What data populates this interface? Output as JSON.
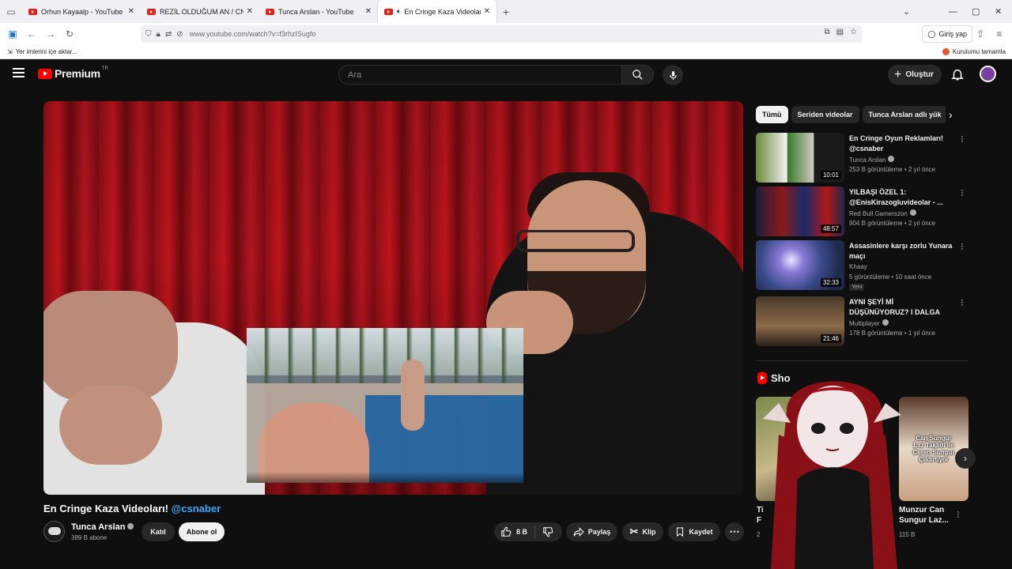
{
  "browser": {
    "tabs": [
      {
        "label": "Orhun Kayaalp - YouTube",
        "active": false
      },
      {
        "label": "REZİL OLDUĞUM AN / CNN MA",
        "active": false
      },
      {
        "label": "Tunca Arslan - YouTube",
        "active": false
      },
      {
        "label": "En Cringe Kaza Videoları! @",
        "active": true
      }
    ],
    "url": "www.youtube.com/watch?v=f3rhzISugfo",
    "signin_label": "Giriş yap",
    "bookmarks_import": "Yer imlerini içe aktar...",
    "setup_label": "Kurulumu tamamla"
  },
  "masthead": {
    "brand": "Premium",
    "region": "TR",
    "search_placeholder": "Ara",
    "create_label": "Oluştur"
  },
  "video": {
    "title": "En Cringe Kaza Videoları!",
    "title_tag": "@csnaber",
    "channel": "Tunca Arslan",
    "subscribers": "389 B abone",
    "join_label": "Katıl",
    "subscribe_label": "Abone ol",
    "likes": "8 B",
    "share_label": "Paylaş",
    "clip_label": "Klip",
    "save_label": "Kaydet"
  },
  "chips": [
    "Tümü",
    "Seriden videolar",
    "Tunca Arslan adlı yük"
  ],
  "recommendations": [
    {
      "title": "En Cringe Oyun Reklamları! @csnaber",
      "channel": "Tunca Arslan",
      "verified": true,
      "meta": "253 B görüntüleme • 2 yıl önce",
      "duration": "10:01",
      "badge": ""
    },
    {
      "title": "YILBAŞI ÖZEL 1: @EnisKirazogluvideolar - ...",
      "channel": "Red Bull Gamerszon",
      "verified": true,
      "meta": "904 B görüntüleme • 2 yıl önce",
      "duration": "48:57",
      "badge": ""
    },
    {
      "title": "Assasinlere karşı zorlu Yunara maçı",
      "channel": "Khaay",
      "verified": false,
      "meta": "5 görüntüleme • 10 saat önce",
      "duration": "32:33",
      "badge": "Yeni"
    },
    {
      "title": "AYNI ŞEYİ Mİ DÜŞÜNÜYORUZ? I DALGA BOYU",
      "channel": "Multiplayer",
      "verified": true,
      "meta": "178 B görüntüleme • 1 yıl önce",
      "duration": "21:46",
      "badge": ""
    }
  ],
  "shorts": {
    "heading": "Sho",
    "items": [
      {
        "title": "Ti\nF",
        "views": "2"
      },
      {
        "title": "Munzur Can\nSungur Laz...",
        "views": "115 B",
        "overlay": "Can Sungur\nLaz Taklidi ile\nCeren Sungur\nÇıldırtıyor"
      }
    ]
  },
  "colors": {
    "accent": "#ff0000",
    "link": "#3ea6ff",
    "background": "#0f0f0f"
  }
}
